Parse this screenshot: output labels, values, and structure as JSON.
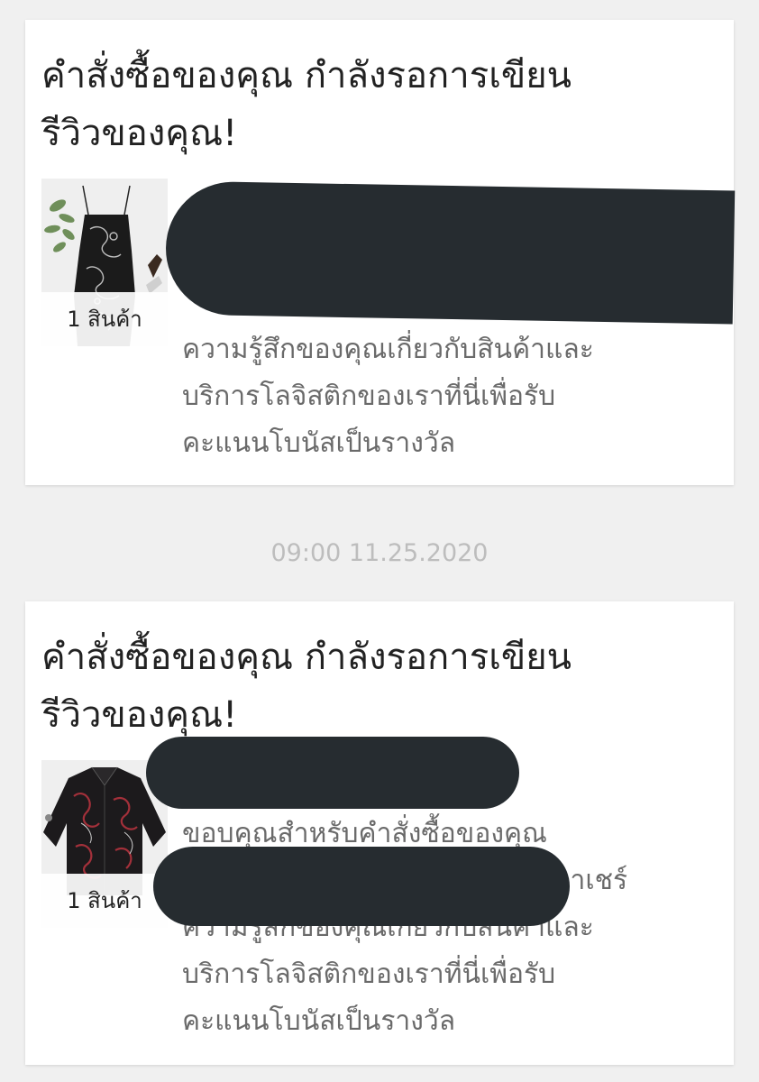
{
  "timestamp": "09:00 11.25.2020",
  "cards": [
    {
      "title_line1": "คำสั่งซื้อของคุณ กำลังรอการเขียน",
      "title_line2": "รีวิวของคุณ!",
      "product_image": "black-dragon-print-slip-dress",
      "quantity_label": "1 สินค้า",
      "body_lines": [
        "ความรู้สึกของคุณเกี่ยวกับสินค้าและ",
        "บริการโลจิสติกของเราที่นี่เพื่อรับ",
        "คะแนนโบนัสเป็นรางวัล"
      ]
    },
    {
      "title_line1": "คำสั่งซื้อของคุณ กำลังรอการเขียน",
      "title_line2": "รีวิวของคุณ!",
      "product_image": "black-dragon-print-shirt",
      "quantity_label": "1 สินค้า",
      "body_lines": [
        "ขอบคุณสำหรับคำสั่งซื้อของคุณ",
        "นาเชร์",
        "ความรู้สึกของคุณเกี่ยวกับสินค้าและ",
        "บริการโลจิสติกของเราที่นี่เพื่อรับ",
        "คะแนนโบนัสเป็นรางวัล"
      ]
    }
  ],
  "colors": {
    "background": "#f0f0f0",
    "card": "#ffffff",
    "title_text": "#222222",
    "body_text": "#6a6a6a",
    "timestamp_text": "#bdbdbd",
    "redaction": "#262c30"
  }
}
